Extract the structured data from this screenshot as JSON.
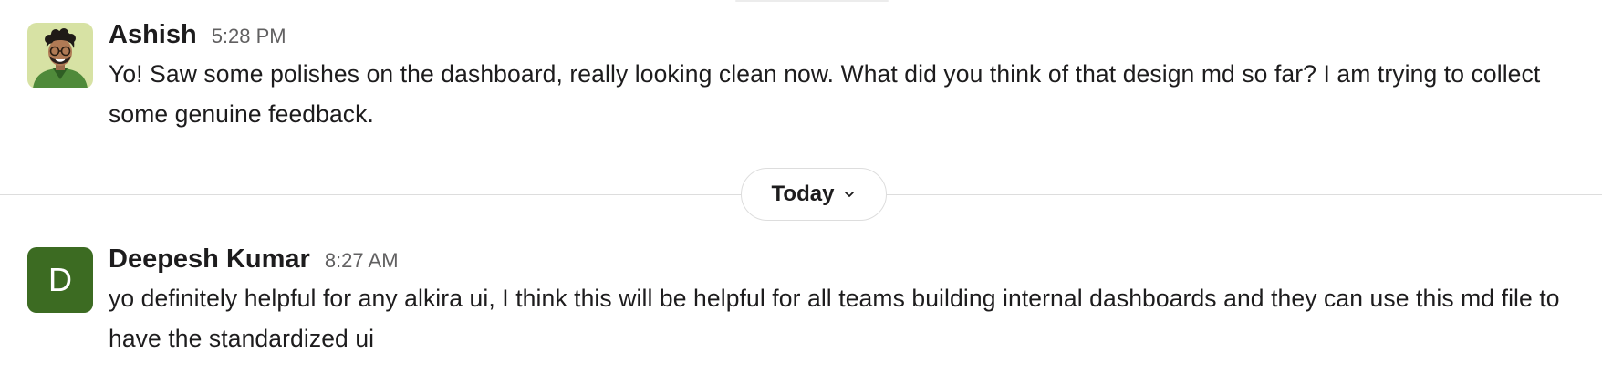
{
  "day_divider": {
    "label": "Today",
    "icon": "chevron-down-icon"
  },
  "messages": [
    {
      "sender": "Ashish",
      "timestamp": "5:28 PM",
      "avatar": {
        "type": "illustrated-portrait",
        "background": "#d7e2a4"
      },
      "text": "Yo! Saw some polishes on the dashboard, really looking clean now. What did you think of that design md so far? I am trying to collect some genuine feedback."
    },
    {
      "sender": "Deepesh Kumar",
      "timestamp": "8:27 AM",
      "avatar": {
        "type": "initial",
        "initial": "D",
        "background": "#3c6b22"
      },
      "text": "yo definitely helpful for any alkira ui, I think this will be helpful for all teams building internal dashboards and they can use this md file to have the standardized ui"
    }
  ],
  "colors": {
    "text": "#1d1c1d",
    "muted": "#616061",
    "divider": "#dddddd"
  }
}
